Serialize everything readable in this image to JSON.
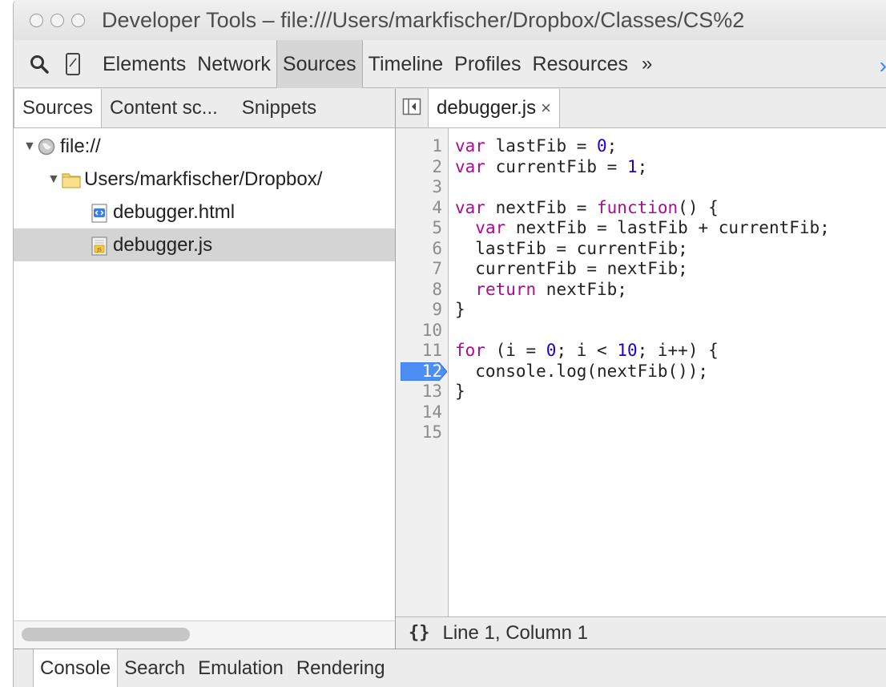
{
  "window": {
    "title": "Developer Tools – file:///Users/markfischer/Dropbox/Classes/CS%2"
  },
  "toolbar": {
    "tabs": [
      "Elements",
      "Network",
      "Sources",
      "Timeline",
      "Profiles",
      "Resources"
    ],
    "active_tab": "Sources",
    "more_label": "»",
    "arrow_label": "›",
    "icons": [
      "search-icon",
      "device-mode-icon"
    ]
  },
  "navigator": {
    "tabs": [
      "Sources",
      "Content sc...",
      "Snippets"
    ],
    "active_tab": "Sources",
    "tree": {
      "root": "file://",
      "folder": "Users/markfischer/Dropbox/",
      "files": [
        "debugger.html",
        "debugger.js"
      ],
      "selected_file": "debugger.js"
    }
  },
  "editor": {
    "open_tab": "debugger.js",
    "close_glyph": "×",
    "line_numbers": [
      "1",
      "2",
      "3",
      "4",
      "5",
      "6",
      "7",
      "8",
      "9",
      "10",
      "11",
      "12",
      "13",
      "14",
      "15"
    ],
    "breakpoint_line": "12",
    "code_lines": [
      "var lastFib = 0;",
      "var currentFib = 1;",
      "",
      "var nextFib = function() {",
      "  var nextFib = lastFib + currentFib;",
      "  lastFib = currentFib;",
      "  currentFib = nextFib;",
      "  return nextFib;",
      "}",
      "",
      "for (i = 0; i < 10; i++) {",
      "  console.log(nextFib());",
      "}",
      "",
      ""
    ],
    "pretty_print_label": "{}",
    "status": "Line 1, Column 1"
  },
  "drawer": {
    "tabs": [
      "Console",
      "Search",
      "Emulation",
      "Rendering"
    ],
    "active_tab": "Console"
  },
  "colors": {
    "accent": "#3a87f3",
    "keyword": "#aa0d91",
    "number": "#1c00cf",
    "breakpoint": "#4c8ef5"
  }
}
